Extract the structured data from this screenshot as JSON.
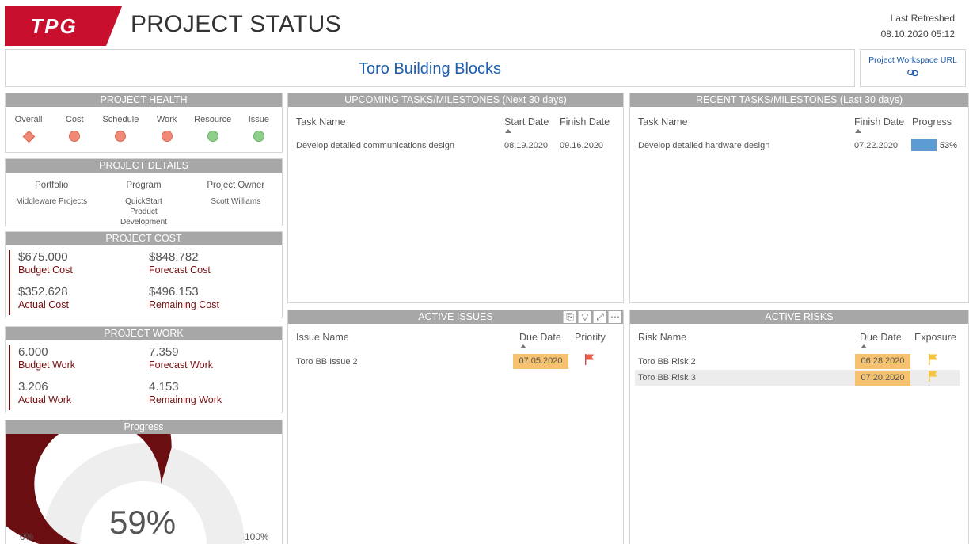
{
  "header": {
    "logo_text": "TPG",
    "title": "PROJECT STATUS",
    "refresh_label": "Last Refreshed",
    "refresh_date": "08.10.2020 05:12"
  },
  "project": {
    "name": "Toro Building Blocks",
    "url_label": "Project Workspace URL",
    "url_icon": "link-icon"
  },
  "colors": {
    "brand_red": "#c8102e",
    "dark_red": "#6f1010",
    "header_gray": "#a7a7a7",
    "status_red": "#f08a76",
    "status_green": "#8fcf8c",
    "date_highlight": "#f6c26f",
    "progress_blue": "#5d9bd5",
    "title_blue": "#1f5fae"
  },
  "health": {
    "title": "PROJECT HEALTH",
    "items": [
      {
        "label": "Overall",
        "status": "red",
        "shape": "diamond"
      },
      {
        "label": "Cost",
        "status": "red",
        "shape": "circle"
      },
      {
        "label": "Schedule",
        "status": "red",
        "shape": "circle"
      },
      {
        "label": "Work",
        "status": "red",
        "shape": "circle"
      },
      {
        "label": "Resource",
        "status": "green",
        "shape": "circle"
      },
      {
        "label": "Issue",
        "status": "green",
        "shape": "circle"
      }
    ]
  },
  "details": {
    "title": "PROJECT DETAILS",
    "columns": [
      {
        "head": "Portfolio",
        "value": "Middleware Projects"
      },
      {
        "head": "Program",
        "value": "QuickStart Product Development"
      },
      {
        "head": "Project Owner",
        "value": "Scott Williams"
      }
    ]
  },
  "cost": {
    "title": "PROJECT COST",
    "budget": {
      "value": "$675.000",
      "label": "Budget Cost"
    },
    "forecast": {
      "value": "$848.782",
      "label": "Forecast Cost"
    },
    "actual": {
      "value": "$352.628",
      "label": "Actual Cost"
    },
    "remaining": {
      "value": "$496.153",
      "label": "Remaining Cost"
    }
  },
  "work": {
    "title": "PROJECT WORK",
    "budget": {
      "value": "6.000",
      "label": "Budget Work"
    },
    "forecast": {
      "value": "7.359",
      "label": "Forecast Work"
    },
    "actual": {
      "value": "3.206",
      "label": "Actual Work"
    },
    "remaining": {
      "value": "4.153",
      "label": "Remaining Work"
    }
  },
  "progress": {
    "title": "Progress",
    "value_text": "59%",
    "fraction": 0.59,
    "min_label": "0%",
    "max_label": "100%"
  },
  "upcoming": {
    "title": "UPCOMING TASKS/MILESTONES (Next 30 days)",
    "columns": [
      "Task Name",
      "Start Date",
      "Finish Date"
    ],
    "rows": [
      {
        "name": "Develop detailed communications design",
        "start": "08.19.2020",
        "finish": "09.16.2020"
      }
    ]
  },
  "recent": {
    "title": "RECENT TASKS/MILESTONES (Last 30 days)",
    "columns": [
      "Task Name",
      "Finish Date",
      "Progress"
    ],
    "rows": [
      {
        "name": "Develop detailed hardware design",
        "finish": "07.22.2020",
        "progress_text": "53%",
        "progress": 0.53
      }
    ]
  },
  "issues": {
    "title": "ACTIVE ISSUES",
    "columns": [
      "Issue Name",
      "Due Date",
      "Priority"
    ],
    "rows": [
      {
        "name": "Toro BB Issue 2",
        "due": "07.05.2020",
        "priority_icon": "red-flag-icon"
      }
    ],
    "tools": [
      "copy-icon",
      "filter-icon",
      "focus-mode-icon",
      "more-options-icon"
    ]
  },
  "risks": {
    "title": "ACTIVE RISKS",
    "columns": [
      "Risk Name",
      "Due Date",
      "Exposure"
    ],
    "rows": [
      {
        "name": "Toro BB Risk 2",
        "due": "06.28.2020",
        "exposure_icon": "yellow-flag-icon"
      },
      {
        "name": "Toro BB Risk 3",
        "due": "07.20.2020",
        "exposure_icon": "yellow-flag-icon"
      }
    ]
  }
}
